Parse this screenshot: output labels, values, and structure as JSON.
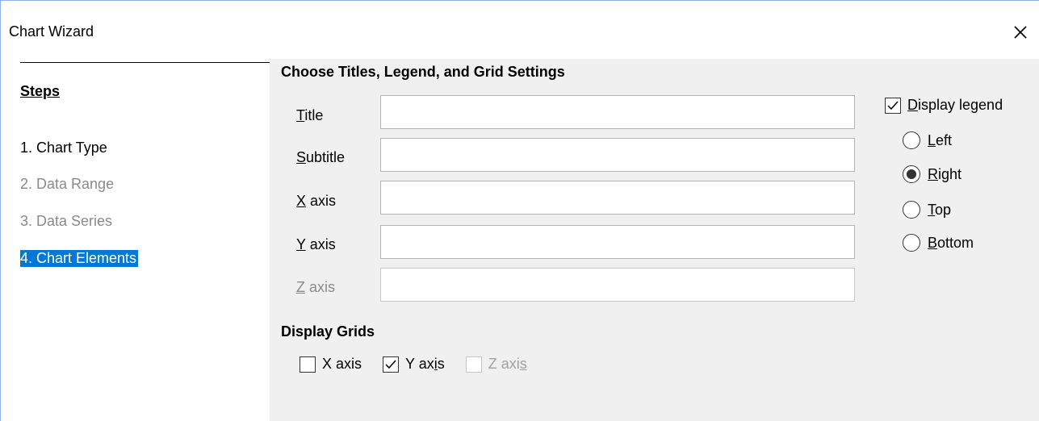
{
  "window": {
    "title": "Chart Wizard"
  },
  "steps": {
    "heading": "Steps",
    "items": [
      {
        "label": "1. Chart Type",
        "state": "enabled"
      },
      {
        "label": "2. Data Range",
        "state": "disabled"
      },
      {
        "label": "3. Data Series",
        "state": "disabled"
      },
      {
        "label": "4. Chart Elements",
        "state": "selected"
      }
    ]
  },
  "titles": {
    "heading": "Choose Titles, Legend, and Grid Settings",
    "fields": [
      {
        "label": "Title",
        "mnemonic": "T",
        "rest": "itle",
        "value": "",
        "enabled": true
      },
      {
        "label": "Subtitle",
        "mnemonic": "S",
        "rest": "ubtitle",
        "value": "",
        "enabled": true
      },
      {
        "label": "X axis",
        "mnemonic": "X",
        "rest": " axis",
        "value": "",
        "enabled": true
      },
      {
        "label": "Y axis",
        "mnemonic": "Y",
        "rest": " axis",
        "value": "",
        "enabled": true
      },
      {
        "label": "Z axis",
        "mnemonic": "Z",
        "rest": " axis",
        "value": "",
        "enabled": false
      }
    ]
  },
  "legend": {
    "display_label_pre": "",
    "display_label_mnemonic": "D",
    "display_label_rest": "isplay legend",
    "display_checked": true,
    "positions": [
      {
        "label": "Left",
        "mnemonic": "L",
        "rest": "eft",
        "selected": false
      },
      {
        "label": "Right",
        "mnemonic": "R",
        "rest": "ight",
        "selected": true
      },
      {
        "label": "Top",
        "mnemonic": "T",
        "rest": "op",
        "selected": false
      },
      {
        "label": "Bottom",
        "mnemonic": "B",
        "rest": "ottom",
        "selected": false
      }
    ]
  },
  "grids": {
    "heading": "Display Grids",
    "x": {
      "label": "X axis",
      "checked": false,
      "enabled": true
    },
    "y": {
      "label_pre": "Y ax",
      "label_mnemonic": "i",
      "label_post": "s",
      "checked": true,
      "enabled": true
    },
    "z": {
      "label_pre": "Z axi",
      "label_mnemonic": "s",
      "label_post": "",
      "checked": false,
      "enabled": false
    }
  },
  "icons": {
    "close": "close-icon",
    "check": "checkmark-icon"
  }
}
